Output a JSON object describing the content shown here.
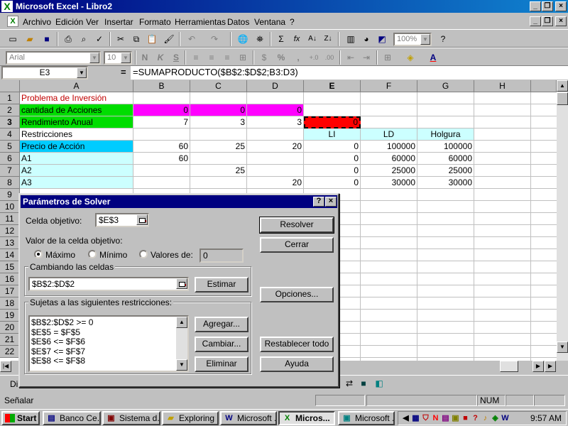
{
  "window": {
    "title": "Microsoft Excel - Libro2",
    "app_icon": "excel-icon"
  },
  "menu": [
    {
      "label": "Archivo"
    },
    {
      "label": "Edición"
    },
    {
      "label": "Ver"
    },
    {
      "label": "Insertar"
    },
    {
      "label": "Formato"
    },
    {
      "label": "Herramientas"
    },
    {
      "label": "Datos"
    },
    {
      "label": "Ventana"
    },
    {
      "label": "?"
    }
  ],
  "toolbar": {
    "zoom": "100%",
    "font": "Arial",
    "font_size": "10",
    "bold": "N",
    "italic": "K",
    "underline": "S",
    "percent": "%",
    "thousands": ",",
    "sigma": "Σ",
    "fx": "fx"
  },
  "formula_bar": {
    "name_box": "E3",
    "equals": "=",
    "formula": "=SUMAPRODUCTO($B$2:$D$2;B3:D3)"
  },
  "sheet": {
    "columns": [
      "A",
      "B",
      "C",
      "D",
      "E",
      "F",
      "G",
      "H"
    ],
    "selected_column": "E",
    "rows": [
      "1",
      "2",
      "3",
      "4",
      "5",
      "6",
      "7",
      "8",
      "9",
      "10",
      "11",
      "12",
      "13",
      "14",
      "15",
      "16",
      "17",
      "18",
      "19",
      "20",
      "21",
      "22"
    ],
    "selected_row": "3",
    "cells": {
      "A1": "Problema de Inversión",
      "A2": "cantidad de Acciones",
      "A3": "Rendimiento Anual",
      "A4": "Restricciones",
      "A5": "Precio de Acción",
      "A6": "A1",
      "A7": "A2",
      "A8": "A3",
      "B2": "0",
      "C2": "0",
      "D2": "0",
      "B3": "7",
      "C3": "3",
      "D3": "3",
      "E3": "0",
      "E4": "LI",
      "F4": "LD",
      "G4": "Holgura",
      "B5": "60",
      "C5": "25",
      "D5": "20",
      "E5": "0",
      "F5": "100000",
      "G5": "100000",
      "B6": "60",
      "E6": "0",
      "F6": "60000",
      "G6": "60000",
      "C7": "25",
      "E7": "0",
      "F7": "25000",
      "G7": "25000",
      "D8": "20",
      "E8": "0",
      "F8": "30000",
      "G8": "30000"
    },
    "colors": {
      "title_text": "#c00000",
      "green": "#00dd00",
      "magenta": "#ff00ff",
      "red": "#ff0000",
      "cyan": "#00ccff",
      "light_cyan": "#ccffff"
    }
  },
  "solver": {
    "title": "Parámetros de Solver",
    "help": "?",
    "close": "×",
    "target_label": "Celda objetivo:",
    "target_value": "$E$3",
    "value_label": "Valor de la celda objetivo:",
    "options": [
      "Máximo",
      "Mínimo",
      "Valores de:"
    ],
    "selected_option": "Máximo",
    "values_of": "0",
    "changing_label": "Cambiando las celdas",
    "changing_value": "$B$2:$D$2",
    "constraints_label": "Sujetas a las siguientes restricciones:",
    "constraints": [
      "$B$2:$D$2 >= 0",
      "$E$5 = $F$5",
      "$E$6 <= $F$6",
      "$E$7 <= $F$7",
      "$E$8 <= $F$8"
    ],
    "buttons": {
      "solve": "Resolver",
      "close": "Cerrar",
      "guess": "Estimar",
      "options": "Opciones...",
      "add": "Agregar...",
      "change": "Cambiar...",
      "delete": "Eliminar",
      "reset": "Restablecer todo",
      "help": "Ayuda"
    }
  },
  "sheet_tab_partial": "Di",
  "status": {
    "text": "Señalar",
    "num": "NUM"
  },
  "taskbar": {
    "start": "Start",
    "items": [
      {
        "label": "Banco Ce...",
        "icon": "document-icon"
      },
      {
        "label": "Sistema d...",
        "icon": "window-icon"
      },
      {
        "label": "Exploring ...",
        "icon": "folder-icon"
      },
      {
        "label": "Microsoft ...",
        "icon": "word-icon"
      },
      {
        "label": "Micros...",
        "icon": "excel-icon",
        "active": true
      },
      {
        "label": "Microsoft ...",
        "icon": "window-icon"
      }
    ],
    "clock": "9:57 AM"
  }
}
